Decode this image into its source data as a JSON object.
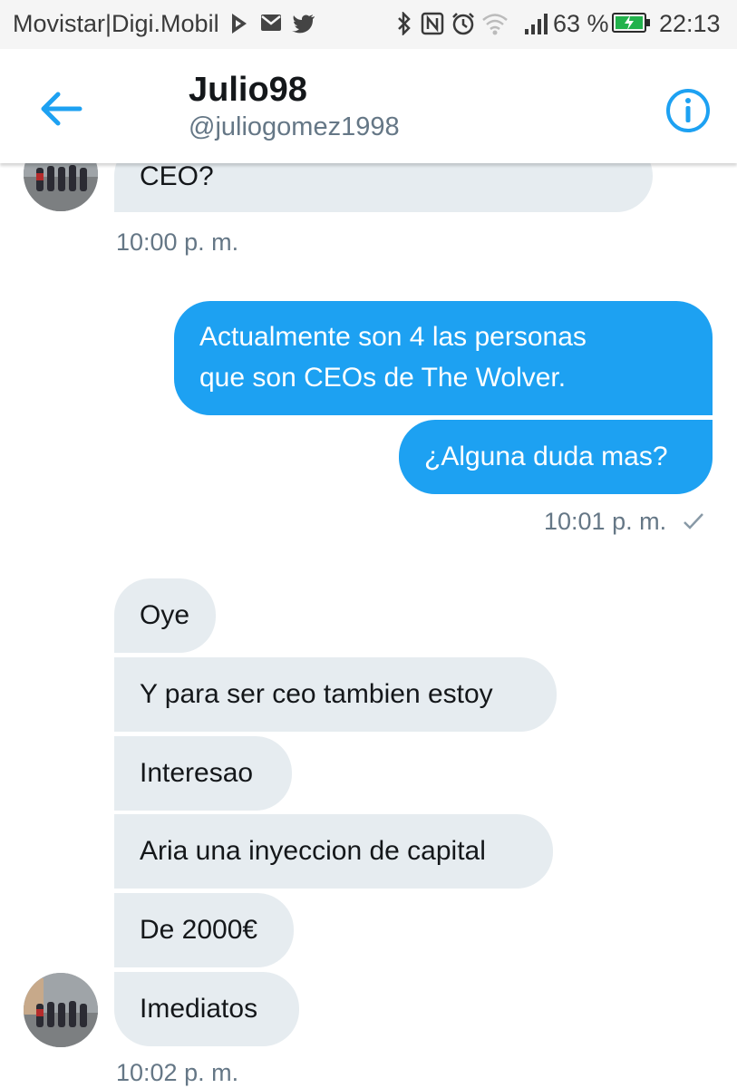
{
  "status_bar": {
    "carrier": "Movistar|Digi.Mobil",
    "battery_percent": "63 %",
    "time": "22:13",
    "icons": [
      "signal-app-icon",
      "mail-icon",
      "twitter-icon",
      "bluetooth-icon",
      "nfc-icon",
      "alarm-icon",
      "wifi-icon",
      "cell-signal-icon",
      "battery-icon"
    ]
  },
  "header": {
    "name": "Julio98",
    "handle": "@juliogomez1998",
    "back_icon": "arrow-left-icon",
    "info_icon": "info-icon",
    "accent_color": "#1da1f2"
  },
  "messages": [
    {
      "id": "m1",
      "direction": "in",
      "text": "CEO?"
    },
    {
      "id": "m1_time",
      "type": "timestamp",
      "text": "10:00 p. m."
    },
    {
      "id": "m2",
      "direction": "out",
      "lines": [
        "Actualmente son 4 las personas",
        "que son CEOs de The Wolver."
      ]
    },
    {
      "id": "m3",
      "direction": "out",
      "text": "¿Alguna duda mas?"
    },
    {
      "id": "m3_time",
      "type": "timestamp",
      "text": "10:01 p. m.",
      "status": "sent-check-icon"
    },
    {
      "id": "m4",
      "direction": "in",
      "text": "Oye"
    },
    {
      "id": "m5",
      "direction": "in",
      "text": "Y para ser ceo tambien estoy"
    },
    {
      "id": "m6",
      "direction": "in",
      "text": "Interesao"
    },
    {
      "id": "m7",
      "direction": "in",
      "text": "Aria una inyeccion de capital"
    },
    {
      "id": "m8",
      "direction": "in",
      "text": "De 2000€"
    },
    {
      "id": "m9",
      "direction": "in",
      "text": "Imediatos"
    },
    {
      "id": "m9_time",
      "type": "timestamp",
      "text": "10:02 p. m."
    }
  ]
}
